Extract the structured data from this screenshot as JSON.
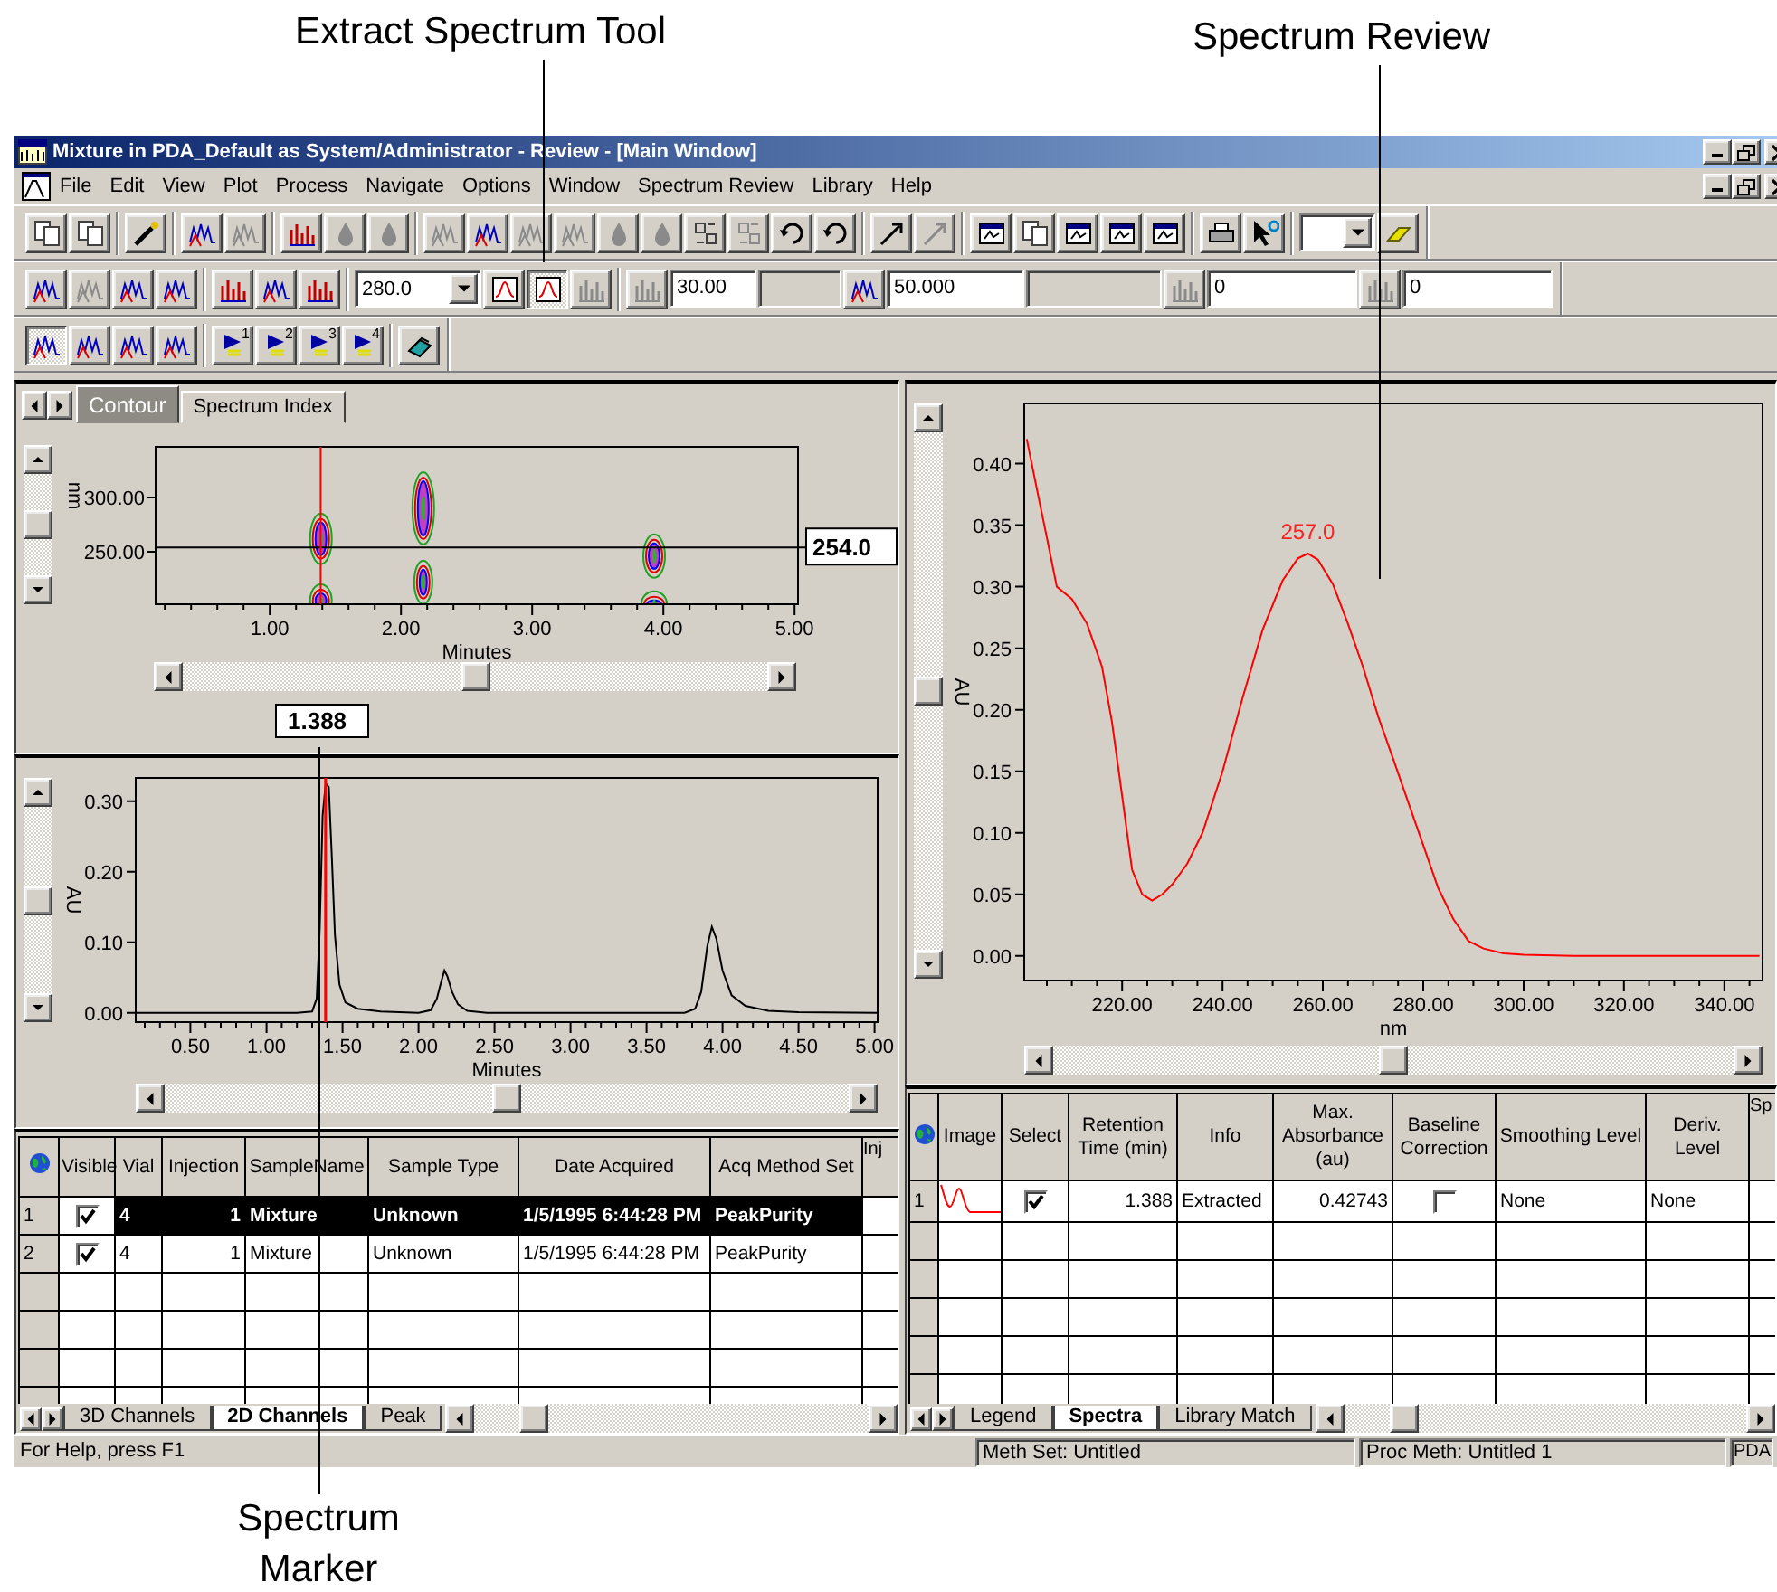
{
  "callouts": [
    {
      "text": "Extract Spectrum Tool"
    },
    {
      "text": "Spectrum Review"
    },
    {
      "text": "Spectrum Marker"
    }
  ],
  "window": {
    "title": "Mixture in PDA_Default as System/Administrator - Review - [Main Window]"
  },
  "menu": [
    "File",
    "Edit",
    "View",
    "Plot",
    "Process",
    "Navigate",
    "Options",
    "Window",
    "Spectrum Review",
    "Library",
    "Help"
  ],
  "toolbars": [
    [
      {
        "kind": "button",
        "disabled": false,
        "pressed": false
      },
      {
        "kind": "button",
        "disabled": false,
        "pressed": false
      },
      {
        "kind": "separator"
      },
      {
        "kind": "button",
        "disabled": false,
        "pressed": false
      },
      {
        "kind": "separator"
      },
      {
        "kind": "button",
        "disabled": false,
        "pressed": false
      },
      {
        "kind": "button",
        "disabled": true,
        "pressed": false
      },
      {
        "kind": "separator"
      },
      {
        "kind": "button",
        "disabled": false,
        "pressed": false
      },
      {
        "kind": "button",
        "disabled": true,
        "pressed": false
      },
      {
        "kind": "button",
        "disabled": true,
        "pressed": false
      },
      {
        "kind": "separator"
      },
      {
        "kind": "button",
        "disabled": true,
        "pressed": false
      },
      {
        "kind": "button",
        "disabled": false,
        "pressed": false
      },
      {
        "kind": "button",
        "disabled": true,
        "pressed": false
      },
      {
        "kind": "button",
        "disabled": true,
        "pressed": false
      },
      {
        "kind": "button",
        "disabled": true,
        "pressed": false
      },
      {
        "kind": "button",
        "disabled": true,
        "pressed": false
      },
      {
        "kind": "button",
        "disabled": false,
        "pressed": false
      },
      {
        "kind": "button",
        "disabled": true,
        "pressed": false
      },
      {
        "kind": "button",
        "disabled": false,
        "pressed": false
      },
      {
        "kind": "button",
        "disabled": false,
        "pressed": false
      },
      {
        "kind": "separator"
      },
      {
        "kind": "button",
        "disabled": false,
        "pressed": false
      },
      {
        "kind": "button",
        "disabled": true,
        "pressed": false
      },
      {
        "kind": "separator"
      },
      {
        "kind": "button",
        "disabled": false,
        "pressed": false
      },
      {
        "kind": "button",
        "disabled": false,
        "pressed": false
      },
      {
        "kind": "button",
        "disabled": false,
        "pressed": false
      },
      {
        "kind": "button",
        "disabled": false,
        "pressed": false
      },
      {
        "kind": "button",
        "disabled": false,
        "pressed": false
      },
      {
        "kind": "separator"
      },
      {
        "kind": "button",
        "disabled": false,
        "pressed": false
      },
      {
        "kind": "button",
        "disabled": false,
        "pressed": false
      },
      {
        "kind": "separator"
      },
      {
        "kind": "combo"
      },
      {
        "kind": "button",
        "disabled": false,
        "pressed": false
      }
    ],
    [
      {
        "kind": "button",
        "disabled": false,
        "pressed": false
      },
      {
        "kind": "button",
        "disabled": true,
        "pressed": false
      },
      {
        "kind": "button",
        "disabled": false,
        "pressed": false
      },
      {
        "kind": "button",
        "disabled": false,
        "pressed": false
      },
      {
        "kind": "separator"
      },
      {
        "kind": "button",
        "disabled": false,
        "pressed": false
      },
      {
        "kind": "button",
        "disabled": false,
        "pressed": false
      },
      {
        "kind": "button",
        "disabled": false,
        "pressed": false
      },
      {
        "kind": "separator"
      },
      {
        "kind": "combo",
        "value": "280.0"
      },
      {
        "kind": "button",
        "disabled": false,
        "pressed": false
      },
      {
        "kind": "button",
        "disabled": false,
        "pressed": true
      },
      {
        "kind": "button",
        "disabled": true,
        "pressed": false
      },
      {
        "kind": "separator"
      },
      {
        "kind": "button",
        "disabled": true,
        "pressed": false
      },
      {
        "kind": "field",
        "value": "30.00",
        "disabled": false
      },
      {
        "kind": "field",
        "disabled": true
      },
      {
        "kind": "button",
        "disabled": false,
        "pressed": false
      },
      {
        "kind": "field",
        "value": "50.000",
        "disabled": false
      },
      {
        "kind": "field",
        "disabled": true
      },
      {
        "kind": "button",
        "disabled": true,
        "pressed": false
      },
      {
        "kind": "field",
        "value": "0",
        "disabled": false
      },
      {
        "kind": "button",
        "disabled": true,
        "pressed": false
      },
      {
        "kind": "field",
        "value": "0",
        "disabled": false
      }
    ],
    [
      {
        "kind": "button",
        "disabled": false,
        "pressed": true
      },
      {
        "kind": "button",
        "disabled": false,
        "pressed": false
      },
      {
        "kind": "button",
        "disabled": false,
        "pressed": false
      },
      {
        "kind": "button",
        "disabled": false,
        "pressed": false
      },
      {
        "kind": "separator"
      },
      {
        "kind": "button",
        "disabled": false,
        "pressed": false,
        "label": "1"
      },
      {
        "kind": "button",
        "disabled": false,
        "pressed": false,
        "label": "2"
      },
      {
        "kind": "button",
        "disabled": false,
        "pressed": false,
        "label": "3"
      },
      {
        "kind": "button",
        "disabled": false,
        "pressed": false,
        "label": "4"
      },
      {
        "kind": "separator"
      },
      {
        "kind": "button",
        "disabled": false,
        "pressed": false
      }
    ]
  ],
  "contour": {
    "tabs": [
      {
        "label": "Contour",
        "selected": true
      },
      {
        "label": "Spectrum Index",
        "selected": false
      }
    ],
    "ylabel": "nm",
    "xlabel": "Minutes",
    "yticks": [
      "300.00",
      "250.00"
    ],
    "xticks": [
      "1.00",
      "2.00",
      "3.00",
      "4.00",
      "5.00"
    ],
    "wavelength": "254.0",
    "time": "1.388"
  },
  "chromatogram": {
    "chart_data": {
      "type": "line",
      "xlabel": "Minutes",
      "ylabel": "AU",
      "x": [
        0.14,
        1.2,
        1.3,
        1.33,
        1.35,
        1.37,
        1.39,
        1.41,
        1.43,
        1.45,
        1.48,
        1.52,
        1.6,
        1.75,
        2.0,
        2.08,
        2.12,
        2.15,
        2.17,
        2.19,
        2.22,
        2.26,
        2.32,
        2.45,
        3.75,
        3.82,
        3.86,
        3.9,
        3.93,
        3.96,
        4.0,
        4.06,
        4.15,
        4.3,
        4.5,
        5.02
      ],
      "values": [
        0,
        0,
        0.002,
        0.02,
        0.12,
        0.28,
        0.325,
        0.32,
        0.22,
        0.11,
        0.04,
        0.015,
        0.006,
        0.002,
        0,
        0.004,
        0.02,
        0.045,
        0.06,
        0.052,
        0.03,
        0.012,
        0.003,
        0,
        0,
        0.006,
        0.03,
        0.095,
        0.122,
        0.105,
        0.06,
        0.025,
        0.01,
        0.003,
        0.001,
        0
      ],
      "xlim": [
        0.14,
        5.02
      ],
      "ylim": [
        -0.013,
        0.333
      ],
      "xticks": [
        {
          "value": 0.5,
          "label": "0.50"
        },
        {
          "value": 1,
          "label": "1.00"
        },
        {
          "value": 1.5,
          "label": "1.50"
        },
        {
          "value": 2,
          "label": "2.00"
        },
        {
          "value": 2.5,
          "label": "2.50"
        },
        {
          "value": 3,
          "label": "3.00"
        },
        {
          "value": 3.5,
          "label": "3.50"
        },
        {
          "value": 4,
          "label": "4.00"
        },
        {
          "value": 4.5,
          "label": "4.50"
        },
        {
          "value": 5,
          "label": "5.00"
        }
      ],
      "yticks": [
        {
          "value": 0,
          "label": "0.00"
        },
        {
          "value": 0.1,
          "label": "0.10"
        },
        {
          "value": 0.2,
          "label": "0.20"
        },
        {
          "value": 0.3,
          "label": "0.30"
        }
      ],
      "ref_lines": [
        {
          "axis": "x",
          "value": 1.388,
          "color": "#ff0000"
        }
      ]
    }
  },
  "spectrum": {
    "chart_data": {
      "type": "line",
      "xlabel": "nm",
      "ylabel": "AU",
      "x": [
        201,
        203,
        205,
        207,
        210,
        213,
        216,
        218,
        220,
        222,
        224,
        226,
        228,
        230,
        233,
        236,
        240,
        244,
        248,
        252,
        255,
        257,
        259,
        262,
        265,
        268,
        271,
        274,
        277,
        280,
        283,
        286,
        289,
        292,
        296,
        300,
        310,
        347
      ],
      "values": [
        0.42,
        0.38,
        0.34,
        0.3,
        0.29,
        0.27,
        0.235,
        0.19,
        0.13,
        0.07,
        0.05,
        0.045,
        0.05,
        0.058,
        0.075,
        0.1,
        0.15,
        0.21,
        0.265,
        0.305,
        0.323,
        0.327,
        0.322,
        0.302,
        0.27,
        0.235,
        0.195,
        0.16,
        0.125,
        0.09,
        0.055,
        0.03,
        0.012,
        0.006,
        0.002,
        0.001,
        0,
        0
      ],
      "xlim": [
        200.5,
        347.6
      ],
      "ylim": [
        -0.02,
        0.449
      ],
      "xticks": [
        {
          "value": 220,
          "label": "220.00"
        },
        {
          "value": 240,
          "label": "240.00"
        },
        {
          "value": 260,
          "label": "260.00"
        },
        {
          "value": 280,
          "label": "280.00"
        },
        {
          "value": 300,
          "label": "300.00"
        },
        {
          "value": 320,
          "label": "320.00"
        },
        {
          "value": 340,
          "label": "340.00"
        }
      ],
      "yticks": [
        {
          "value": 0,
          "label": "0.00"
        },
        {
          "value": 0.05,
          "label": "0.05"
        },
        {
          "value": 0.1,
          "label": "0.10"
        },
        {
          "value": 0.15,
          "label": "0.15"
        },
        {
          "value": 0.2,
          "label": "0.20"
        },
        {
          "value": 0.25,
          "label": "0.25"
        },
        {
          "value": 0.3,
          "label": "0.30"
        },
        {
          "value": 0.35,
          "label": "0.35"
        },
        {
          "value": 0.4,
          "label": "0.40"
        }
      ],
      "annotations": [
        {
          "x": 257,
          "y": 0.327,
          "text": "257.0"
        }
      ]
    }
  },
  "channels_table": {
    "columns": [
      {
        "label": "Visible",
        "kind": "check"
      },
      {
        "label": "Vial",
        "kind": "text"
      },
      {
        "label": "Injection",
        "kind": "number"
      },
      {
        "label": "SampleName",
        "kind": "text"
      },
      {
        "label": "Sample Type",
        "kind": "text"
      },
      {
        "label": "Date Acquired",
        "kind": "text"
      },
      {
        "label": "Acq Method Set",
        "kind": "text"
      },
      {
        "label": "Inj"
      }
    ],
    "rows": [
      {
        "number": "1",
        "selected": true,
        "cells": [
          true,
          "4",
          "1",
          "Mixture",
          "Unknown",
          "1/5/1995 6:44:28 PM",
          "PeakPurity"
        ]
      },
      {
        "number": "2",
        "selected": false,
        "cells": [
          true,
          "4",
          "1",
          "Mixture",
          "Unknown",
          "1/5/1995 6:44:28 PM",
          "PeakPurity"
        ]
      }
    ],
    "tabs": [
      {
        "label": "3D Channels",
        "selected": false
      },
      {
        "label": "2D Channels",
        "selected": true
      },
      {
        "label": "Peak",
        "selected": false
      }
    ]
  },
  "spectra_table": {
    "columns": [
      {
        "label": "Image",
        "kind": "picture"
      },
      {
        "label": "Select",
        "kind": "check"
      },
      {
        "label": "Retention Time (min)",
        "kind": "number"
      },
      {
        "label": "Info",
        "kind": "text"
      },
      {
        "label": "Max. Absorbance (au)",
        "kind": "number"
      },
      {
        "label": "Baseline Correction",
        "kind": "check"
      },
      {
        "label": "Smoothing Level",
        "kind": "text"
      },
      {
        "label": "Deriv. Level",
        "kind": "text"
      },
      {
        "label": "Sp"
      }
    ],
    "rows": [
      {
        "number": "1",
        "selected": false,
        "cells": [
          {
            "kind": "picture"
          },
          true,
          "1.388",
          "Extracted",
          "0.42743",
          false,
          "None",
          "None"
        ]
      }
    ],
    "tabs": [
      {
        "label": "Legend",
        "selected": false
      },
      {
        "label": "Spectra",
        "selected": true
      },
      {
        "label": "Library Match",
        "selected": false
      }
    ]
  },
  "status_bar": [
    "For Help, press F1",
    "Meth Set: Untitled",
    "Proc Meth: Untitled 1",
    "PDA"
  ]
}
